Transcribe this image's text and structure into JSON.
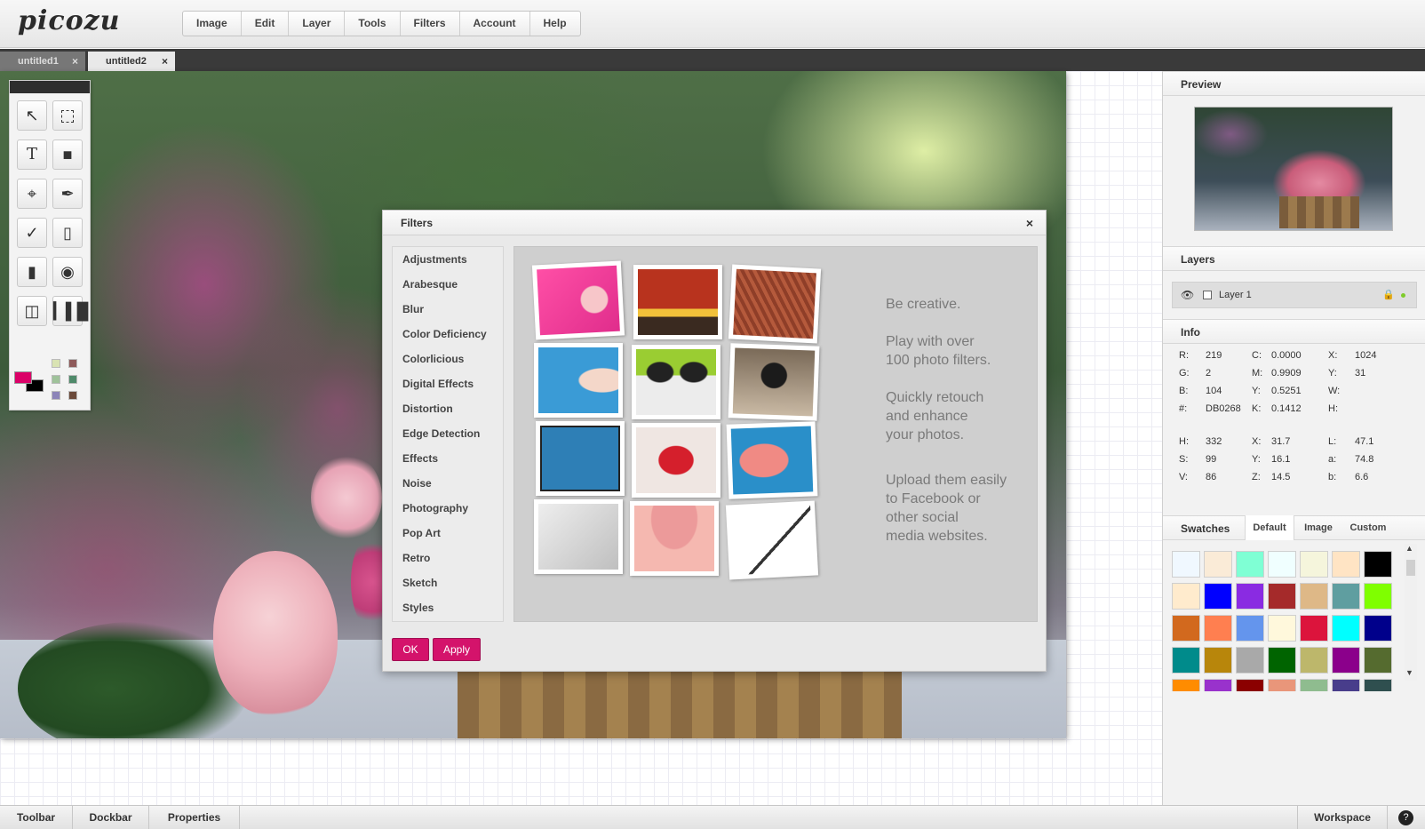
{
  "app": {
    "logo": "picozu"
  },
  "menu": [
    "Image",
    "Edit",
    "Layer",
    "Tools",
    "Filters",
    "Account",
    "Help"
  ],
  "tabs": [
    {
      "label": "untitled1",
      "close": "×"
    },
    {
      "label": "untitled2",
      "close": "×"
    }
  ],
  "dialog": {
    "title": "Filters",
    "close": "×",
    "categories": [
      "Adjustments",
      "Arabesque",
      "Blur",
      "Color Deficiency",
      "Colorlicious",
      "Digital Effects",
      "Distortion",
      "Edge Detection",
      "Effects",
      "Noise",
      "Photography",
      "Pop Art",
      "Retro",
      "Sketch",
      "Styles"
    ],
    "promo": [
      [
        "Be creative."
      ],
      [
        "Play with over",
        "100 photo filters."
      ],
      [
        "Quickly retouch",
        "and enhance",
        "your photos."
      ],
      [
        "Upload them easily",
        "to Facebook or",
        "other  social",
        "media websites."
      ]
    ],
    "ok_label": "OK",
    "apply_label": "Apply"
  },
  "panels": {
    "preview": {
      "title": "Preview"
    },
    "layers": {
      "title": "Layers",
      "items": [
        {
          "name": "Layer 1"
        }
      ]
    },
    "info": {
      "title": "Info",
      "rows1": [
        [
          [
            "R:",
            "219"
          ],
          [
            "C:",
            "0.0000"
          ],
          [
            "X:",
            "1024"
          ]
        ],
        [
          [
            "G:",
            "2"
          ],
          [
            "M:",
            "0.9909"
          ],
          [
            "Y:",
            "31"
          ]
        ],
        [
          [
            "B:",
            "104"
          ],
          [
            "Y:",
            "0.5251"
          ],
          [
            "W:",
            ""
          ]
        ],
        [
          [
            "#:",
            "DB0268"
          ],
          [
            "K:",
            "0.1412"
          ],
          [
            "H:",
            ""
          ]
        ]
      ],
      "rows2": [
        [
          [
            "H:",
            "332"
          ],
          [
            "X:",
            "31.7"
          ],
          [
            "L:",
            "47.1"
          ]
        ],
        [
          [
            "S:",
            "99"
          ],
          [
            "Y:",
            "16.1"
          ],
          [
            "a:",
            "74.8"
          ]
        ],
        [
          [
            "V:",
            "86"
          ],
          [
            "Z:",
            "14.5"
          ],
          [
            "b:",
            "6.6"
          ]
        ]
      ]
    },
    "swatches": {
      "title": "Swatches",
      "tabs": [
        "Default",
        "Image",
        "Custom"
      ],
      "colors": [
        [
          "#f0f8ff",
          "#faebd7",
          "#7fffd4",
          "#f0ffff",
          "#f5f5dc",
          "#ffe4c4",
          "#000000"
        ],
        [
          "#ffebcd",
          "#0000ff",
          "#8a2be2",
          "#a52a2a",
          "#deb887",
          "#5f9ea0",
          "#7fff00"
        ],
        [
          "#d2691e",
          "#ff7f50",
          "#6495ed",
          "#fff8dc",
          "#dc143c",
          "#00ffff",
          "#00008b"
        ],
        [
          "#008b8b",
          "#b8860b",
          "#a9a9a9",
          "#006400",
          "#bdb76b",
          "#8b008b",
          "#556b2f"
        ],
        [
          "#ff8c00",
          "#9932cc",
          "#8b0000",
          "#e9967a",
          "#8fbc8f",
          "#483d8b",
          "#2f4f4f"
        ]
      ]
    }
  },
  "toolbar": {
    "tools": [
      "move-tool-icon",
      "marquee-tool-icon",
      "text-tool-icon",
      "shape-tool-icon",
      "crop-tool-icon",
      "brush-tool-icon",
      "eyedropper-tool-icon",
      "eraser-tool-icon",
      "ruler-tool-icon",
      "fill-tool-icon",
      "spray-tool-icon",
      "histogram-tool-icon"
    ],
    "foreground": "#DB0268",
    "background": "#000000",
    "mini_swatches": [
      "#d9e3b3",
      "#8e5a5a",
      "#9fc29a",
      "#4f8a6a",
      "#8c84b8",
      "#6b4a3a"
    ]
  },
  "statusbar": {
    "buttons": [
      "Toolbar",
      "Dockbar",
      "Properties"
    ],
    "workspace_label": "Workspace"
  },
  "colors": {
    "accent": "#d4136b",
    "tab_bar": "#3a3a3a"
  }
}
